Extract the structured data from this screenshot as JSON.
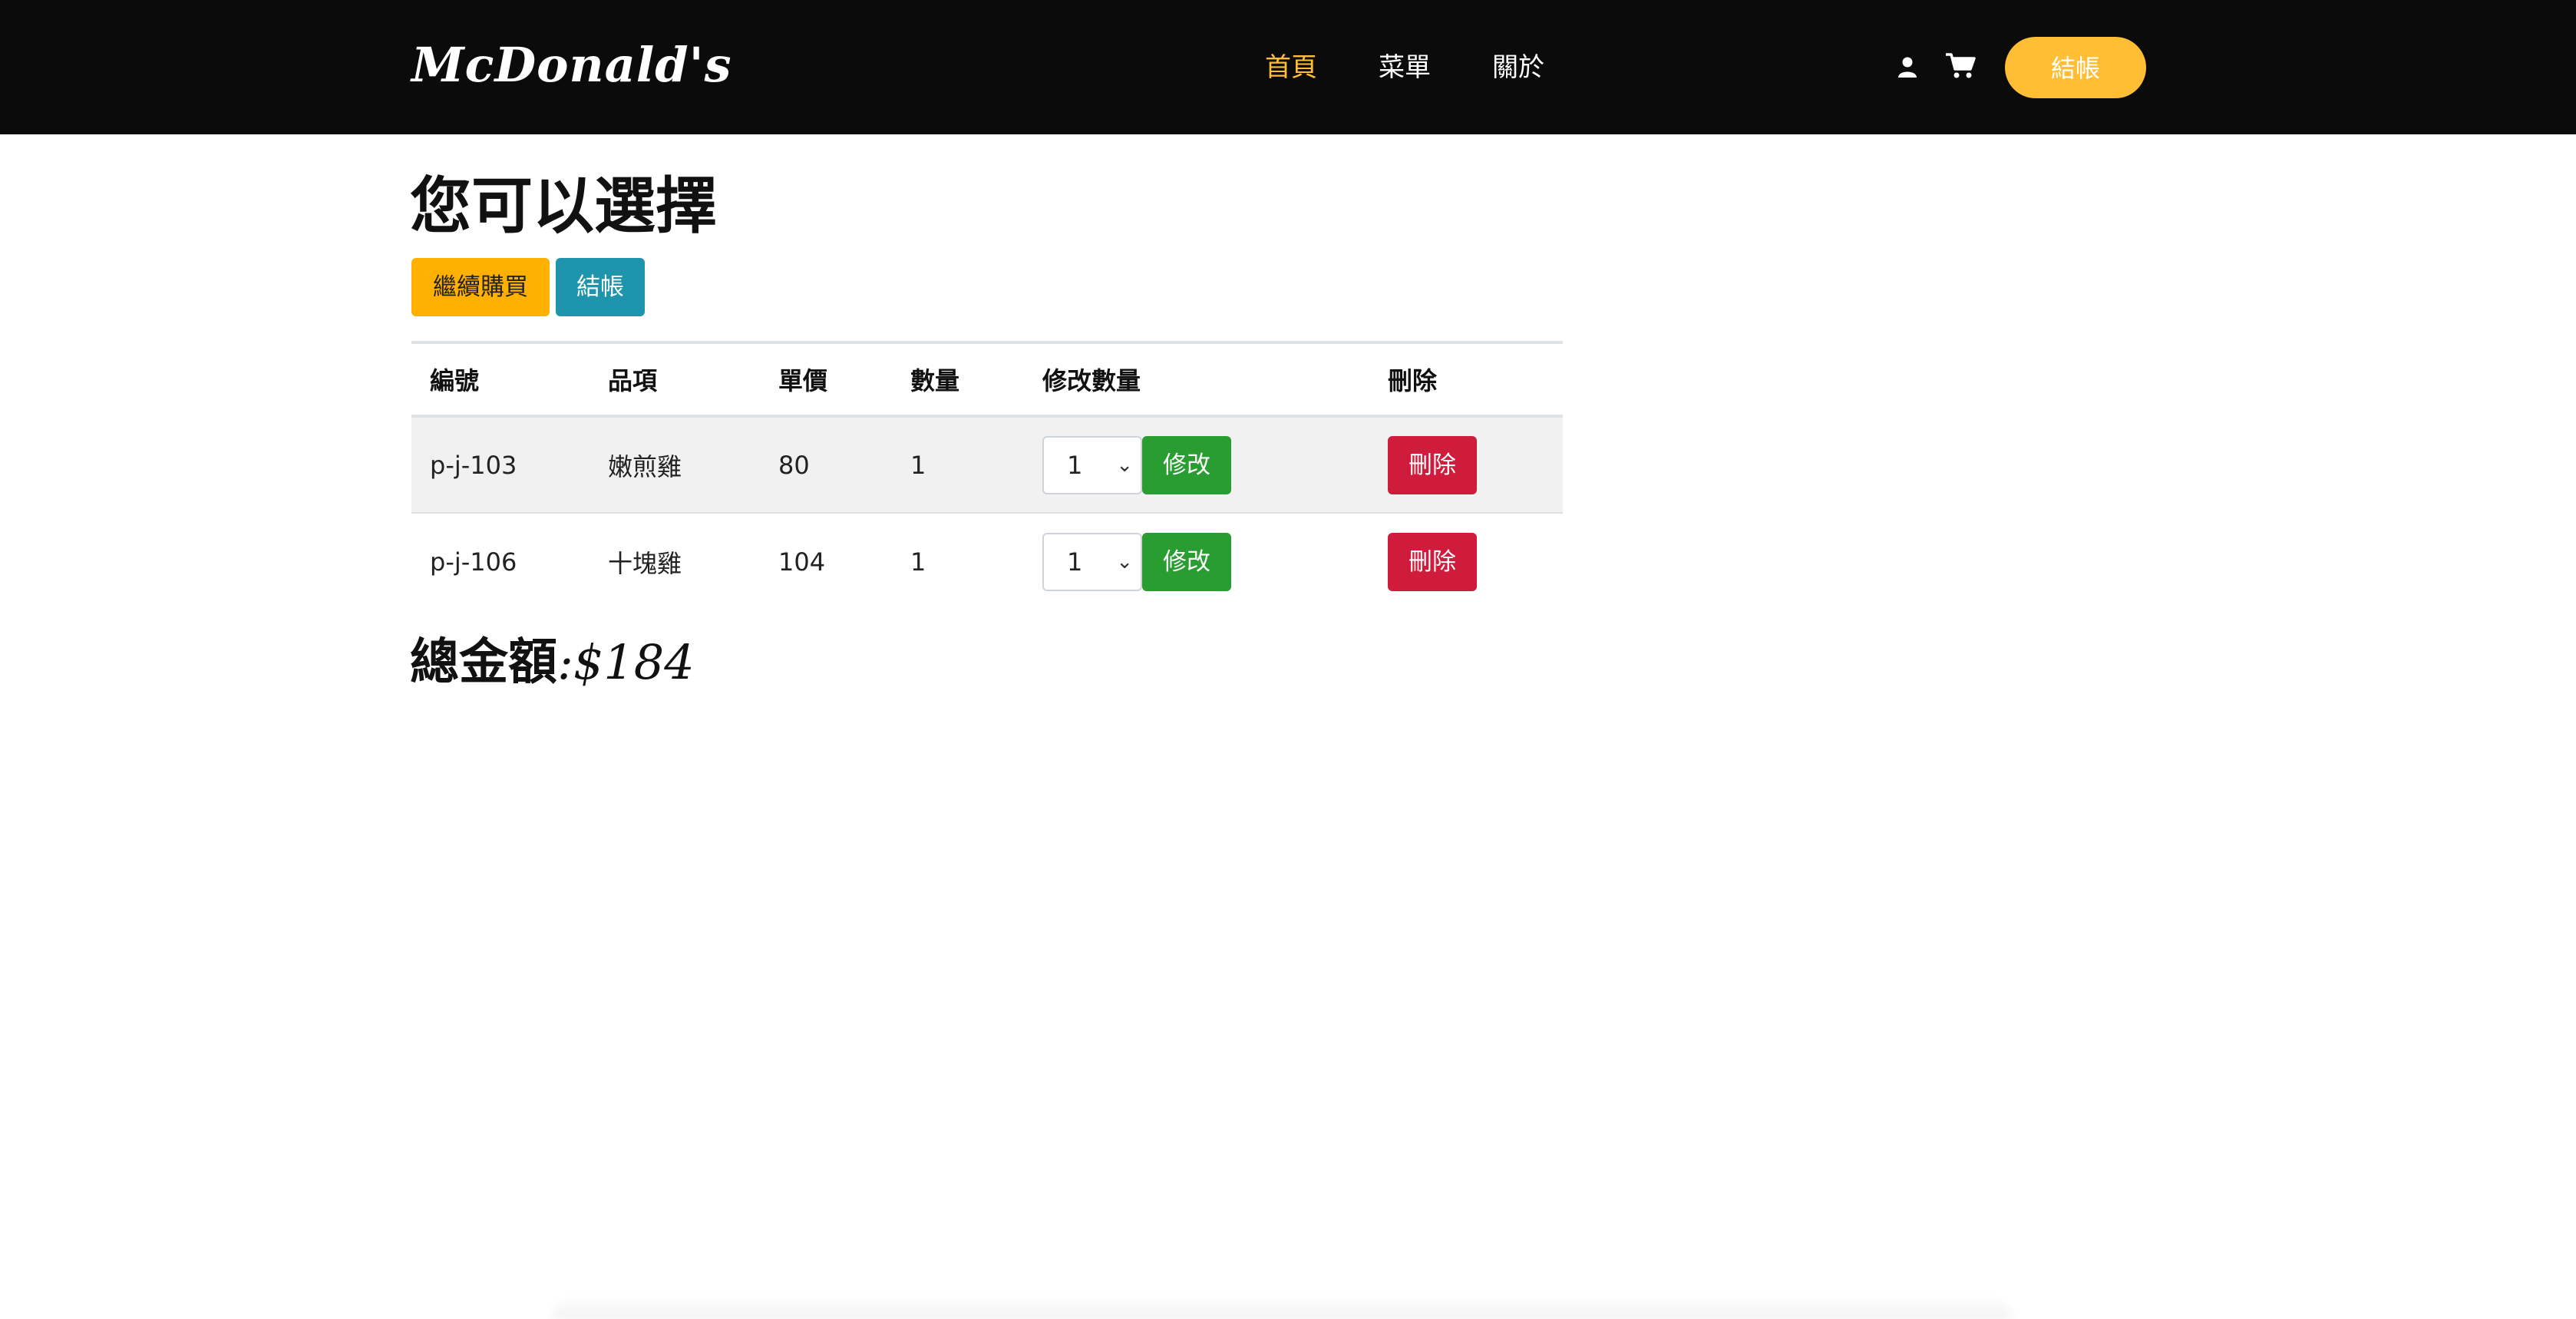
{
  "header": {
    "logo": "McDonald's",
    "nav": [
      "首頁",
      "菜單",
      "關於"
    ],
    "active_nav": "首頁",
    "user_icon": "user-icon",
    "cart_icon": "cart-icon",
    "order_button": "結帳"
  },
  "main": {
    "title": "您可以選擇",
    "continue_button": "繼續購買",
    "checkout_button": "結帳",
    "table": {
      "headers": [
        "編號",
        "品項",
        "單價",
        "數量",
        "修改數量",
        "刪除"
      ],
      "rows": [
        {
          "id": "p-j-103",
          "item": "嫩煎雞",
          "price": "80",
          "qty": "1",
          "qty_select": "1",
          "edit": "修改",
          "delete": "刪除"
        },
        {
          "id": "p-j-106",
          "item": "十塊雞",
          "price": "104",
          "qty": "1",
          "qty_select": "1",
          "edit": "修改",
          "delete": "刪除"
        }
      ]
    },
    "total_label": "總金額",
    "total_amount": ":$184"
  },
  "colors": {
    "header_bg": "#0b0b0b",
    "accent": "#ffbe33",
    "continue_btn": "#ffb000",
    "checkout_btn": "#1f95ad",
    "edit_btn": "#2a9d32",
    "delete_btn": "#d01c3c"
  }
}
